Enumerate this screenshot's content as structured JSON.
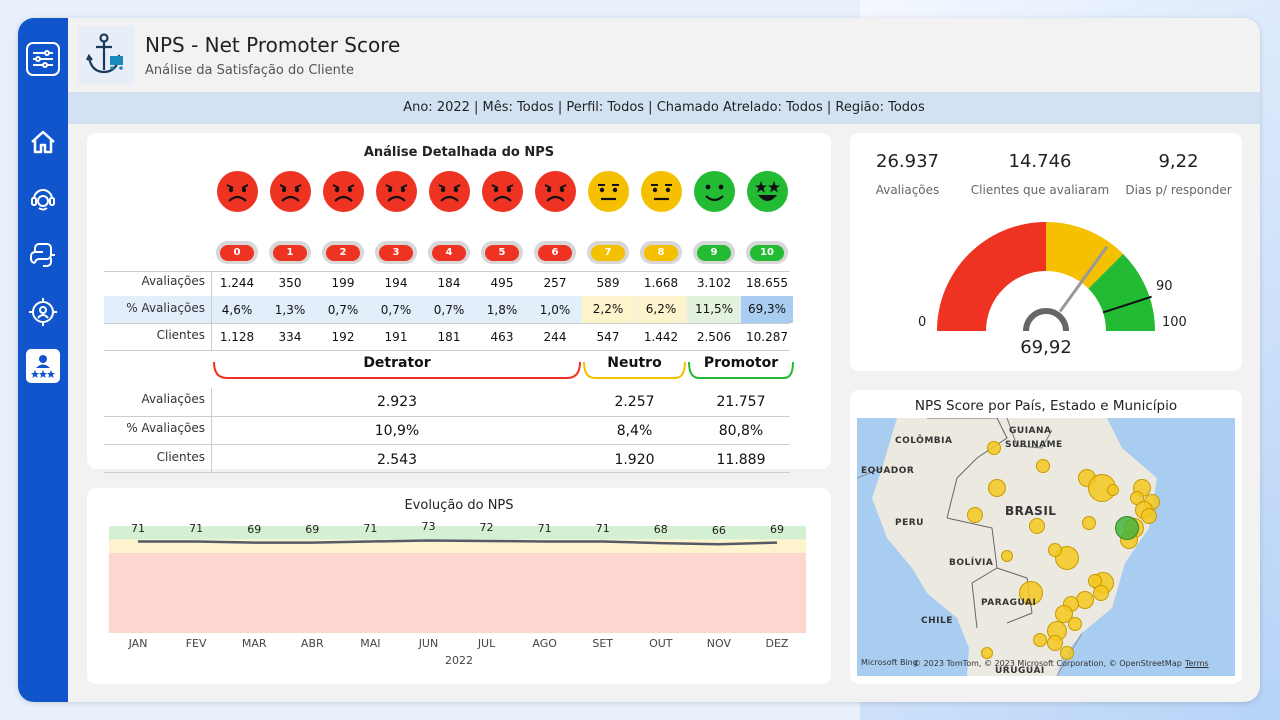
{
  "header": {
    "title": "NPS - Net Promoter Score",
    "subtitle": "Análise da Satisfação do Cliente"
  },
  "filters": "Ano: 2022 | Mês: Todos | Perfil: Todos | Chamado Atrelado: Todos | Região: Todos",
  "detail": {
    "title": "Análise Detalhada do NPS",
    "row_labels": {
      "avaliacoes": "Avaliações",
      "pct": "% Avaliações",
      "clientes": "Clientes"
    },
    "scores": [
      "0",
      "1",
      "2",
      "3",
      "4",
      "5",
      "6",
      "7",
      "8",
      "9",
      "10"
    ],
    "avaliacoes": [
      "1.244",
      "350",
      "199",
      "194",
      "184",
      "495",
      "257",
      "589",
      "1.668",
      "3.102",
      "18.655"
    ],
    "pct": [
      "4,6%",
      "1,3%",
      "0,7%",
      "0,7%",
      "0,7%",
      "1,8%",
      "1,0%",
      "2,2%",
      "6,2%",
      "11,5%",
      "69,3%"
    ],
    "clientes": [
      "1.128",
      "334",
      "192",
      "191",
      "181",
      "463",
      "244",
      "547",
      "1.442",
      "2.506",
      "10.287"
    ],
    "colors": {
      "detrator": "#ee3322",
      "neutro": "#f5c000",
      "promotor": "#22bb33"
    }
  },
  "summary": {
    "groups": [
      "Detrator",
      "Neutro",
      "Promotor"
    ],
    "row_labels": {
      "avaliacoes": "Avaliações",
      "pct": "% Avaliações",
      "clientes": "Clientes"
    },
    "avaliacoes": [
      "2.923",
      "2.257",
      "21.757"
    ],
    "pct": [
      "10,9%",
      "8,4%",
      "80,8%"
    ],
    "clientes": [
      "2.543",
      "1.920",
      "11.889"
    ]
  },
  "kpis": [
    {
      "value": "26.937",
      "label": "Avaliações"
    },
    {
      "value": "14.746",
      "label": "Clientes que avaliaram"
    },
    {
      "value": "9,22",
      "label": "Dias p/ responder"
    }
  ],
  "gauge": {
    "value": 69.92,
    "value_label": "69,92",
    "min_label": "0",
    "max_label": "100",
    "target_label": "90",
    "min": 0,
    "max": 100,
    "target": 90,
    "bands": [
      0,
      50,
      75,
      100
    ]
  },
  "map": {
    "title": "NPS Score por País, Estado e Município",
    "labels": [
      "GUIANA",
      "COLÔMBIA",
      "SURINAME",
      "EQUADOR",
      "BRASIL",
      "PERU",
      "BOLÍVIA",
      "PARAGUAI",
      "CHILE",
      "URUGUAI"
    ],
    "attribution": "© 2023 TomTom, © 2023 Microsoft Corporation, © OpenStreetMap",
    "terms": "Terms",
    "brand": "Microsoft Bing"
  },
  "chart_data": {
    "type": "line",
    "title": "Evolução do NPS",
    "xlabel": "2022",
    "categories": [
      "JAN",
      "FEV",
      "MAR",
      "ABR",
      "MAI",
      "JUN",
      "JUL",
      "AGO",
      "SET",
      "OUT",
      "NOV",
      "DEZ"
    ],
    "values": [
      71,
      71,
      69,
      69,
      71,
      73,
      72,
      71,
      71,
      68,
      66,
      69
    ],
    "ylim": [
      -100,
      100
    ],
    "bands": [
      {
        "from": -100,
        "to": 50,
        "color": "#fdd6d0"
      },
      {
        "from": 50,
        "to": 75,
        "color": "#fdf3cc"
      },
      {
        "from": 75,
        "to": 100,
        "color": "#d4f0d2"
      }
    ],
    "line_color": "#555a66"
  }
}
